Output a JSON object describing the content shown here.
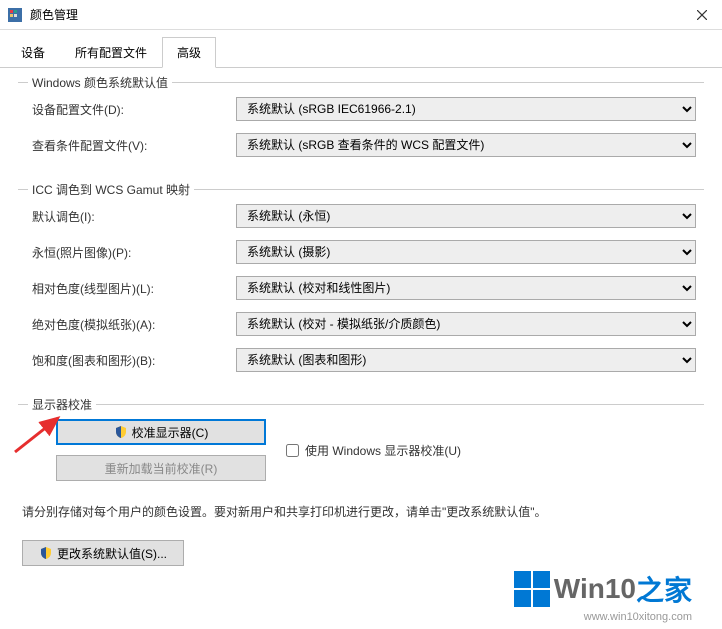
{
  "window": {
    "title": "颜色管理",
    "close_aria": "Close"
  },
  "tabs": [
    {
      "label": "设备"
    },
    {
      "label": "所有配置文件"
    },
    {
      "label": "高级"
    }
  ],
  "group_defaults": {
    "legend": "Windows 颜色系统默认值",
    "rows": {
      "device_profile": {
        "label": "设备配置文件(D):",
        "value": "系统默认 (sRGB IEC61966-2.1)"
      },
      "viewing_conditions": {
        "label": "查看条件配置文件(V):",
        "value": "系统默认 (sRGB 查看条件的 WCS 配置文件)"
      }
    }
  },
  "group_gamut": {
    "legend": "ICC 调色到 WCS Gamut 映射",
    "rows": {
      "default_rendering": {
        "label": "默认调色(I):",
        "value": "系统默认 (永恒)"
      },
      "perceptual": {
        "label": "永恒(照片图像)(P):",
        "value": "系统默认 (摄影)"
      },
      "relative": {
        "label": "相对色度(线型图片)(L):",
        "value": "系统默认 (校对和线性图片)"
      },
      "absolute": {
        "label": "绝对色度(模拟纸张)(A):",
        "value": "系统默认 (校对 - 模拟纸张/介质颜色)"
      },
      "saturation": {
        "label": "饱和度(图表和图形)(B):",
        "value": "系统默认 (图表和图形)"
      }
    }
  },
  "group_calibration": {
    "legend": "显示器校准",
    "calibrate_btn": "校准显示器(C)",
    "reload_btn": "重新加载当前校准(R)",
    "use_wincal": "使用 Windows 显示器校准(U)"
  },
  "hint": "请分别存储对每个用户的颜色设置。要对新用户和共享打印机进行更改，请单击\"更改系统默认值\"。",
  "change_defaults_btn": "更改系统默认值(S)...",
  "watermark": {
    "line1a": "Win10",
    "line1b": "之家",
    "line2": "www.win10xitong.com"
  }
}
